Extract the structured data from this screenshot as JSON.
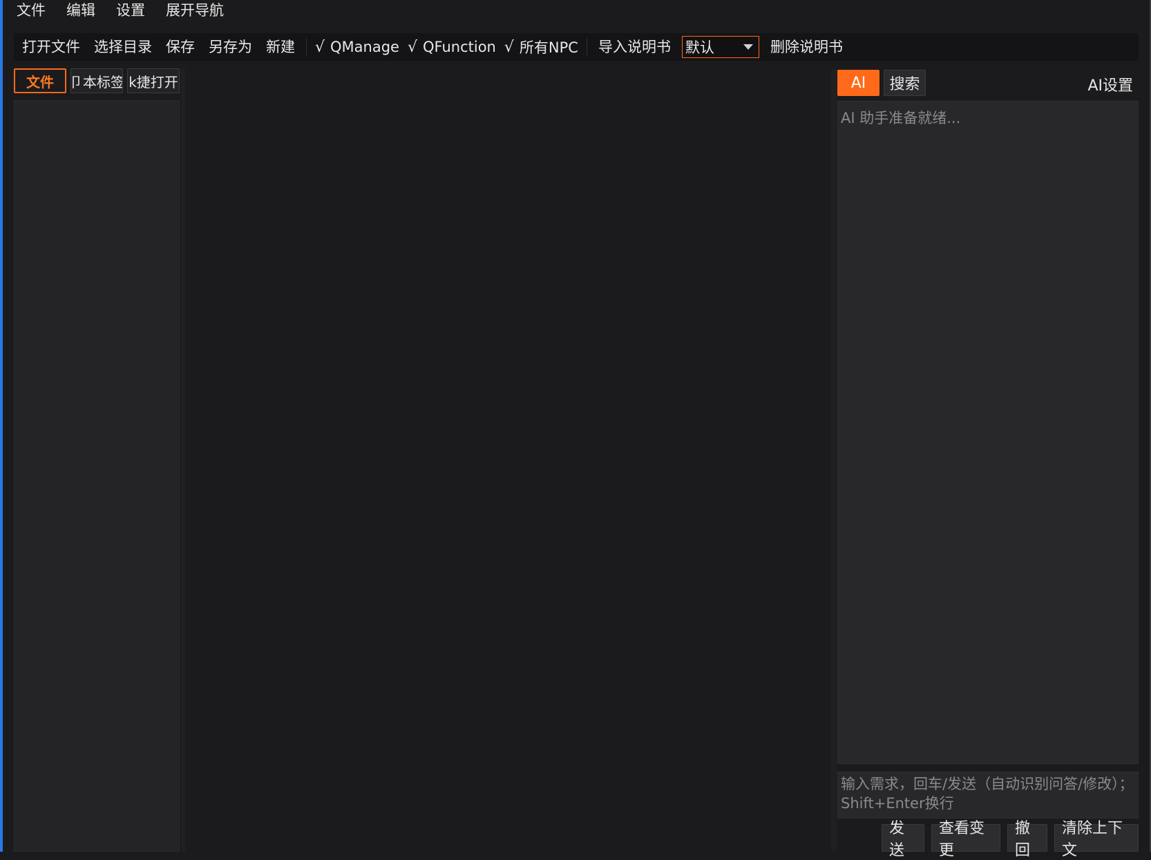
{
  "menubar": {
    "items": [
      "文件",
      "编辑",
      "设置",
      "展开导航"
    ]
  },
  "toolbar": {
    "open_file": "打开文件",
    "select_dir": "选择目录",
    "save": "保存",
    "save_as": "另存为",
    "new": "新建",
    "check_mark": "√",
    "qmanage": "QManage",
    "qfunction": "QFunction",
    "all_npc": "所有NPC",
    "import_manual": "导入说明书",
    "manual_combo_value": "默认",
    "delete_manual": "删除说明书"
  },
  "left_panel": {
    "tabs": [
      "文件",
      "卩本标签",
      "k捷打开"
    ],
    "active_tab": "文件"
  },
  "ai_panel": {
    "tab_ai": "AI",
    "tab_search": "搜索",
    "settings": "AI设置",
    "status": "AI 助手准备就绪...",
    "input_placeholder": "输入需求，回车/发送（自动识别问答/修改）；Shift+Enter换行",
    "buttons": {
      "send": "发送",
      "view_changes": "查看变更",
      "undo": "撤回",
      "clear_context": "清除上下文"
    }
  },
  "colors": {
    "accent": "#ff6a1a",
    "background": "#1b1b1d",
    "panel": "#28282b",
    "left_accent": "#2a78e4"
  }
}
